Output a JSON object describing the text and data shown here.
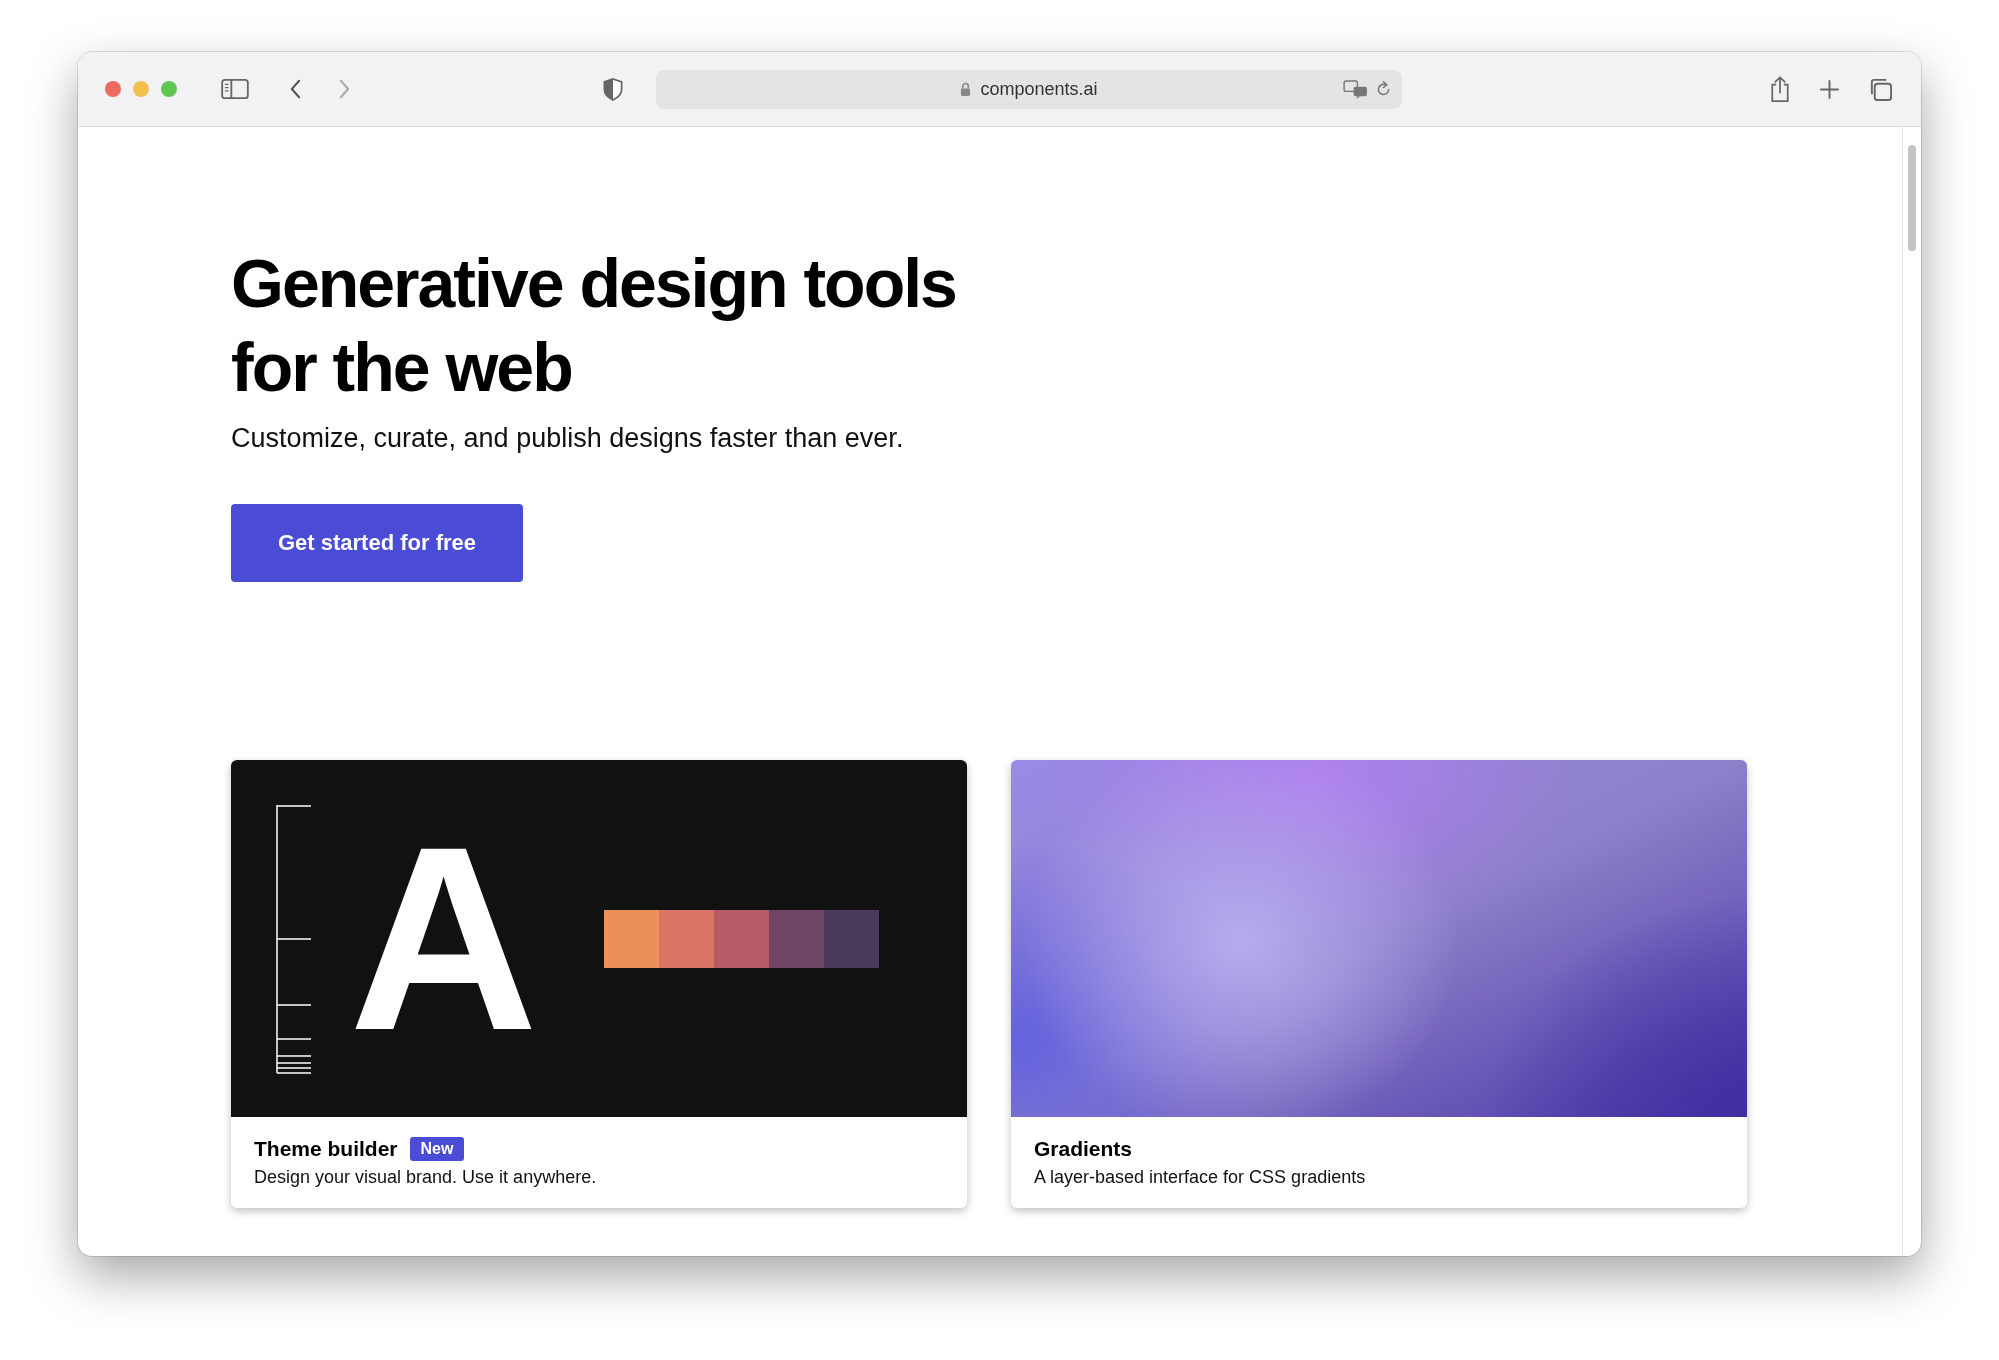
{
  "browser": {
    "url": "components.ai"
  },
  "hero": {
    "title": "Generative design tools for the web",
    "subtitle": "Customize, curate, and publish designs faster than ever.",
    "cta": "Get started for free"
  },
  "cards": [
    {
      "kind": "theme",
      "title": "Theme builder",
      "badge": "New",
      "description": "Design your visual brand. Use it anywhere.",
      "letter": "A",
      "swatches": [
        {
          "color": "#ea9159"
        },
        {
          "color": "#d97466"
        },
        {
          "color": "#b85a67"
        },
        {
          "color": "#6f4566"
        },
        {
          "color": "#4a3a5c"
        }
      ]
    },
    {
      "kind": "gradient",
      "title": "Gradients",
      "description": "A layer-based interface for CSS gradients"
    }
  ]
}
